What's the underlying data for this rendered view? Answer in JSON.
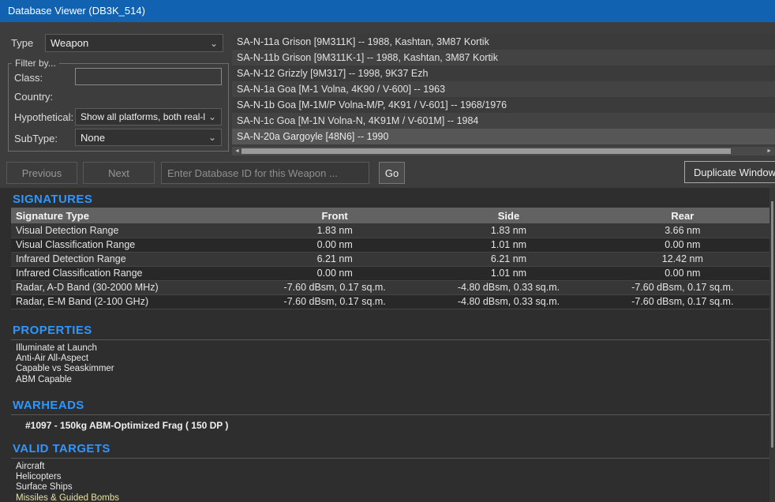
{
  "colors": {
    "titlebar_bg": "#1262b2",
    "panel_bg": "#3d3d3d",
    "content_bg": "#2e2e2e",
    "heading_text": "#2e96ff",
    "target_highlight": "#e6e3a0"
  },
  "titlebar": {
    "title": "Database Viewer (DB3K_514)"
  },
  "filters": {
    "type_label": "Type",
    "type_value": "Weapon",
    "group_label": "Filter by...",
    "class_label": "Class:",
    "class_value": "",
    "country_label": "Country:",
    "hypothetical_label": "Hypothetical:",
    "hypothetical_value": "Show all platforms, both real-l",
    "subtype_label": "SubType:",
    "subtype_value": "None"
  },
  "weapon_list": {
    "items": [
      {
        "label": "SA-N-11a Grison [9M311K] -- 1988, Kashtan, 3M87 Kortik",
        "selected": false
      },
      {
        "label": "SA-N-11b Grison [9M311K-1] -- 1988, Kashtan, 3M87 Kortik",
        "selected": false
      },
      {
        "label": "SA-N-12 Grizzly [9M317] -- 1998, 9K37 Ezh",
        "selected": false
      },
      {
        "label": "SA-N-1a Goa [M-1 Volna, 4K90 / V-600] -- 1963",
        "selected": false
      },
      {
        "label": "SA-N-1b Goa [M-1M/P Volna-M/P, 4K91 / V-601] -- 1968/1976",
        "selected": false
      },
      {
        "label": "SA-N-1c Goa [M-1N Volna-N, 4K91M / V-601M] -- 1984",
        "selected": false
      },
      {
        "label": "SA-N-20a Gargoyle [48N6] -- 1990",
        "selected": true
      }
    ]
  },
  "toolbar": {
    "previous_label": "Previous",
    "next_label": "Next",
    "db_id_placeholder": "Enter Database ID for this Weapon ...",
    "go_label": "Go",
    "duplicate_label": "Duplicate Window"
  },
  "signatures": {
    "heading": "SIGNATURES",
    "columns": [
      "Signature Type",
      "Front",
      "Side",
      "Rear"
    ],
    "rows": [
      [
        "Visual Detection Range",
        "1.83 nm",
        "1.83 nm",
        "3.66 nm"
      ],
      [
        "Visual Classification Range",
        "0.00 nm",
        "1.01 nm",
        "0.00 nm"
      ],
      [
        "Infrared Detection Range",
        "6.21 nm",
        "6.21 nm",
        "12.42 nm"
      ],
      [
        "Infrared Classification Range",
        "0.00 nm",
        "1.01 nm",
        "0.00 nm"
      ],
      [
        "Radar, A-D Band (30-2000 MHz)",
        "-7.60 dBsm, 0.17 sq.m.",
        "-4.80 dBsm, 0.33 sq.m.",
        "-7.60 dBsm, 0.17 sq.m."
      ],
      [
        "Radar, E-M Band (2-100 GHz)",
        "-7.60 dBsm, 0.17 sq.m.",
        "-4.80 dBsm, 0.33 sq.m.",
        "-7.60 dBsm, 0.17 sq.m."
      ]
    ]
  },
  "properties": {
    "heading": "PROPERTIES",
    "items": [
      "Illuminate at Launch",
      "Anti-Air All-Aspect",
      "Capable vs Seaskimmer",
      "ABM Capable"
    ]
  },
  "warheads": {
    "heading": "WARHEADS",
    "items": [
      "#1097 - 150kg ABM-Optimized Frag ( 150 DP )"
    ]
  },
  "valid_targets": {
    "heading": "VALID TARGETS",
    "items": [
      {
        "label": "Aircraft"
      },
      {
        "label": "Helicopters"
      },
      {
        "label": "Surface Ships"
      },
      {
        "label": "Missiles & Guided Bombs",
        "highlight": true
      }
    ]
  }
}
